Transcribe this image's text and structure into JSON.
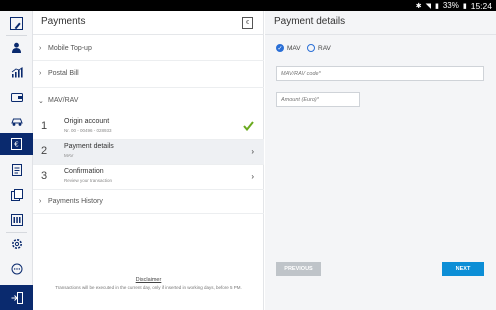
{
  "status_bar": {
    "battery": "33%",
    "time": "15:24"
  },
  "middle": {
    "title": "Payments",
    "sections": [
      {
        "label": "Mobile Top-up"
      },
      {
        "label": "Postal Bill"
      }
    ],
    "mav_rav": {
      "label": "MAV/RAV"
    },
    "steps": [
      {
        "num": "1",
        "title": "Origin account",
        "sub": "Nr. 00 - 00496 - 028933"
      },
      {
        "num": "2",
        "title": "Payment details",
        "sub": "MAV"
      },
      {
        "num": "3",
        "title": "Confirmation",
        "sub": "Review your transaction"
      }
    ],
    "history": {
      "label": "Payments History"
    },
    "disclaimer_link": "Disclaimer",
    "disclaimer_text": "Transactions will be executed in the current day, only if inserted in working days, before 5 PM."
  },
  "right": {
    "title": "Payment details",
    "radios": [
      {
        "label": "MAV",
        "checked": true
      },
      {
        "label": "RAV",
        "checked": false
      }
    ],
    "code_placeholder": "MAV/RAV code*",
    "amount_placeholder": "Amount (Euro)*",
    "prev_label": "PREVIOUS",
    "next_label": "NEXT"
  },
  "colors": {
    "brand": "#0a2a6e",
    "accent": "#0c8ed6",
    "check": "#6aaa1e",
    "radio": "#2a6fd6"
  }
}
